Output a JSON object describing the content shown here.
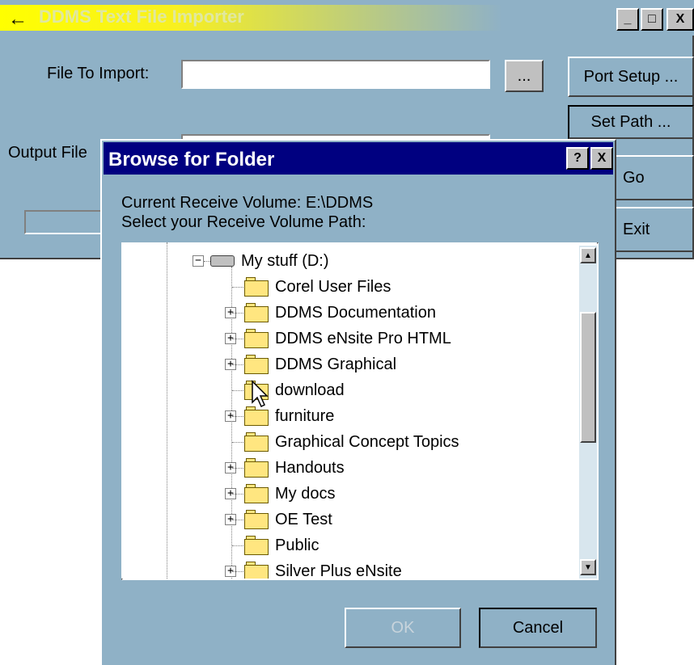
{
  "main_window": {
    "title": "DDMS Text File Importer",
    "file_to_import_label": "File To Import:",
    "file_to_import_value": "",
    "browse_label": "...",
    "port_setup_label": "Port Setup ...",
    "set_path_label": "Set Path ...",
    "output_file_label": "Output File",
    "go_label": "Go",
    "exit_label": "Exit",
    "minimize_glyph": "_",
    "maximize_glyph": "□",
    "close_glyph": "X"
  },
  "dialog": {
    "title": "Browse for Folder",
    "help_glyph": "?",
    "close_glyph": "X",
    "current_volume": "Current Receive Volume: E:\\DDMS",
    "instruction": "Select your Receive Volume Path:",
    "ok_label": "OK",
    "cancel_label": "Cancel",
    "tree": {
      "root": "My stuff (D:)",
      "items": [
        {
          "label": "Corel User Files",
          "expandable": false
        },
        {
          "label": "DDMS Documentation",
          "expandable": true
        },
        {
          "label": "DDMS eNsite Pro HTML",
          "expandable": true
        },
        {
          "label": "DDMS Graphical",
          "expandable": true
        },
        {
          "label": "download",
          "expandable": false
        },
        {
          "label": "furniture",
          "expandable": true
        },
        {
          "label": "Graphical Concept Topics",
          "expandable": false
        },
        {
          "label": "Handouts",
          "expandable": true
        },
        {
          "label": "My docs",
          "expandable": true
        },
        {
          "label": "OE Test",
          "expandable": true
        },
        {
          "label": "Public",
          "expandable": false
        },
        {
          "label": "Silver Plus eNsite",
          "expandable": true
        }
      ]
    }
  },
  "colors": {
    "window_bg": "#8fb1c6",
    "dialog_title_bg": "#000080",
    "main_title_gradient_start": "#ffff00"
  }
}
